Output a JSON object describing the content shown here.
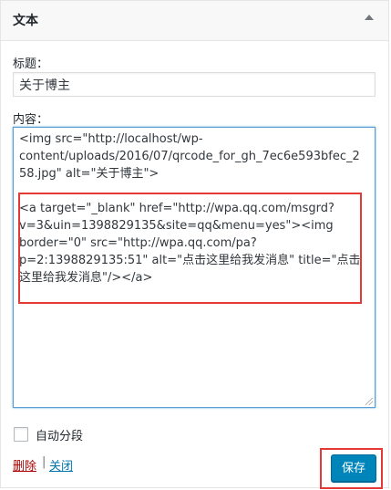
{
  "widget": {
    "title": "文本"
  },
  "form": {
    "title_label": "标题：",
    "title_value": "关于博主",
    "content_label": "内容：",
    "content_lines": [
      "<img src=\"http://localhost/wp-",
      "content/uploads/2016/07/qrcode_for_gh_7ec6e593bfec_2",
      "58.jpg\" alt=\"关于博主\">",
      "",
      "<a target=\"_blank\" href=\"http://wpa.qq.com/msgrd?",
      "v=3&uin=1398829135&site=qq&menu=yes\"><img",
      "border=\"0\" src=\"http://wpa.qq.com/pa?",
      "p=2:1398829135:51\" alt=\"点击这里给我发消息\" title=\"点击",
      "这里给我发消息\"/></a>"
    ],
    "autop_label": "自动分段",
    "autop_checked": false
  },
  "actions": {
    "delete_label": "删除",
    "separator": "|",
    "close_label": "关闭",
    "save_label": "保存"
  },
  "colors": {
    "primary_button": "#0085ba",
    "link": "#0073aa",
    "delete_link": "#aa0000",
    "annotation_box": "#e53935",
    "focus_border": "#5b9dd9"
  }
}
